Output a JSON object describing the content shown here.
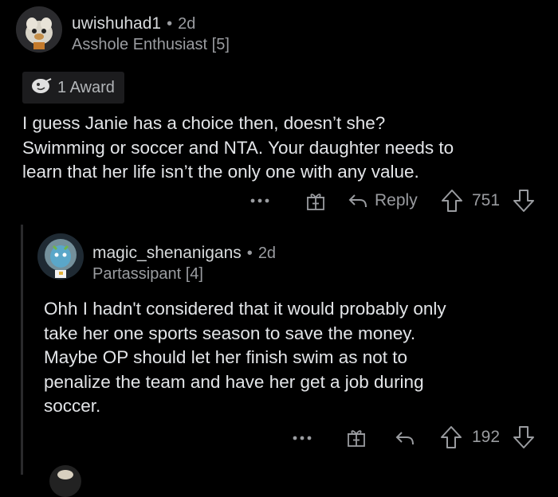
{
  "comment": {
    "username": "uwishuhad1",
    "dot": "•",
    "age": "2d",
    "flair": "Asshole Enthusiast [5]",
    "award_label": "1 Award",
    "body_lines": [
      "I guess Janie has a choice then, doesn’t she?",
      "Swimming or soccer and NTA. Your daughter needs to",
      "learn that her life isn’t the only one with any value."
    ],
    "reply_label": "Reply",
    "score": "751"
  },
  "reply": {
    "username": "magic_shenanigans",
    "dot": "•",
    "age": "2d",
    "flair": "Partassipant [4]",
    "body_lines": [
      "Ohh I hadn't considered that it would probably only",
      "take her one sports season to save the money.",
      "Maybe OP should let her finish swim as not to",
      "penalize the team and have her get a job during",
      "soccer."
    ],
    "score": "192"
  },
  "icons": {
    "more": "more-options-icon",
    "gift": "give-award-icon",
    "reply": "reply-arrow-icon",
    "upvote": "upvote-arrow-icon",
    "downvote": "downvote-arrow-icon"
  },
  "colors": {
    "background": "#000000",
    "text": "#d7dadc",
    "muted": "#9a9ca0"
  }
}
